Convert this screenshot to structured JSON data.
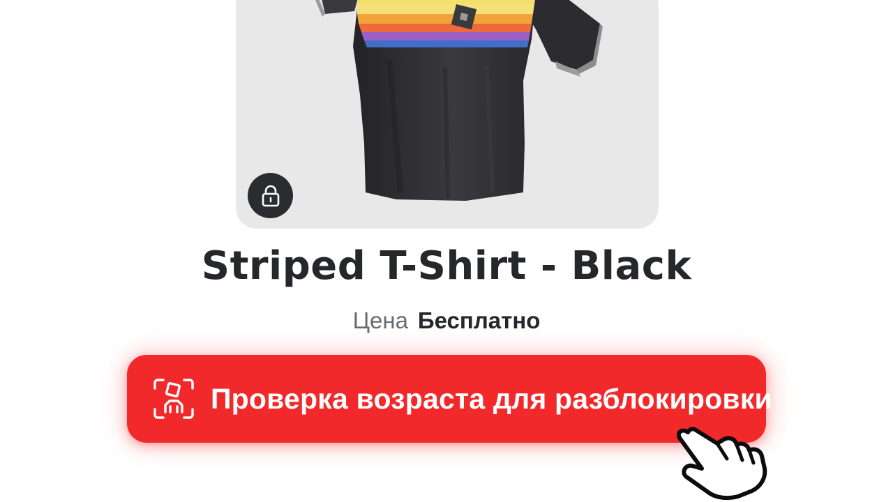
{
  "item": {
    "title": "Striped T-Shirt - Black",
    "price_label": "Цена",
    "price_value": "Бесплатно",
    "locked_icon": "lock-icon"
  },
  "cta": {
    "label": "Проверка возраста для разблокировки",
    "icon": "face-scan-icon",
    "color": "#f2292b"
  },
  "cursor": {
    "icon": "pointing-hand-cursor-icon"
  },
  "colors": {
    "card_background": "#e8e8e8",
    "title_text": "#26272b",
    "muted_text": "#6a6b70",
    "badge_background": "#2b2c30"
  }
}
